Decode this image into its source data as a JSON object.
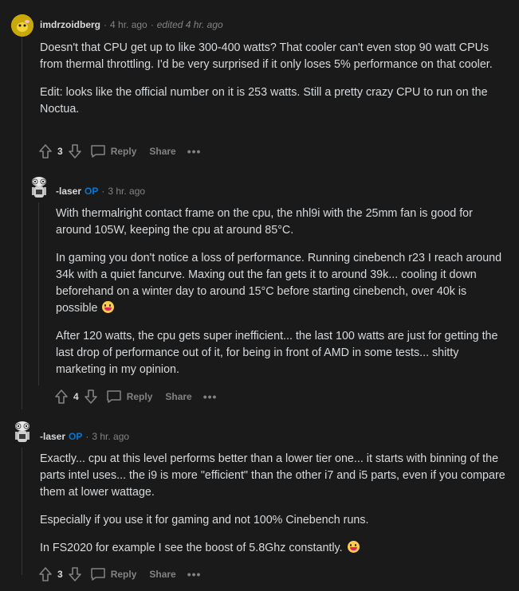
{
  "comments": [
    {
      "username": "imdrzoidberg",
      "time": "4 hr. ago",
      "edited": "edited 4 hr. ago",
      "paragraphs": [
        "Doesn't that CPU get up to like 300-400 watts? That cooler can't even stop 90 watt CPUs from thermal throttling. I'd be very surprised if it only loses 5% performance on that cooler.",
        "Edit: looks like the official number on it is 253 watts. Still a pretty crazy CPU to run on the Noctua."
      ],
      "score": "3",
      "reply_label": "Reply",
      "share_label": "Share",
      "more_label": "•••"
    },
    {
      "username": "-laser",
      "op_label": "OP",
      "time": "3 hr. ago",
      "paragraphs": [
        "With thermalright contact frame on the cpu, the nhl9i with the 25mm fan is good for around 105W, keeping the cpu at around 85°C.",
        "In gaming you don't notice a loss of performance. Running cinebench r23 I reach around 34k with a quiet fancurve. Maxing out the fan gets it to around 39k... cooling it down beforehand on a winter day to around 15°C before starting cinebench, over 40k is possible",
        "After 120 watts, the cpu gets super inefficient... the last 100 watts are just for getting the last drop of performance out of it, for being in front of AMD in some tests... shitty marketing in my opinion."
      ],
      "score": "4",
      "reply_label": "Reply",
      "share_label": "Share",
      "more_label": "•••"
    },
    {
      "username": "-laser",
      "op_label": "OP",
      "time": "3 hr. ago",
      "paragraphs": [
        "Exactly... cpu at this level performs better than a lower tier one... it starts with binning of the parts intel uses... the i9 is more \"efficient\" than the other i7 and i5 parts, even if you compare them at lower wattage.",
        "Especially if you use it for gaming and not 100% Cinebench runs.",
        "In FS2020 for example I see the boost of 5.8Ghz constantly."
      ],
      "score": "3",
      "reply_label": "Reply",
      "share_label": "Share",
      "more_label": "•••"
    }
  ],
  "colors": {
    "background": "#1a1a1b",
    "text": "#d7dadc",
    "muted": "#818384",
    "op": "#0079d3",
    "thread_line": "#343536"
  }
}
